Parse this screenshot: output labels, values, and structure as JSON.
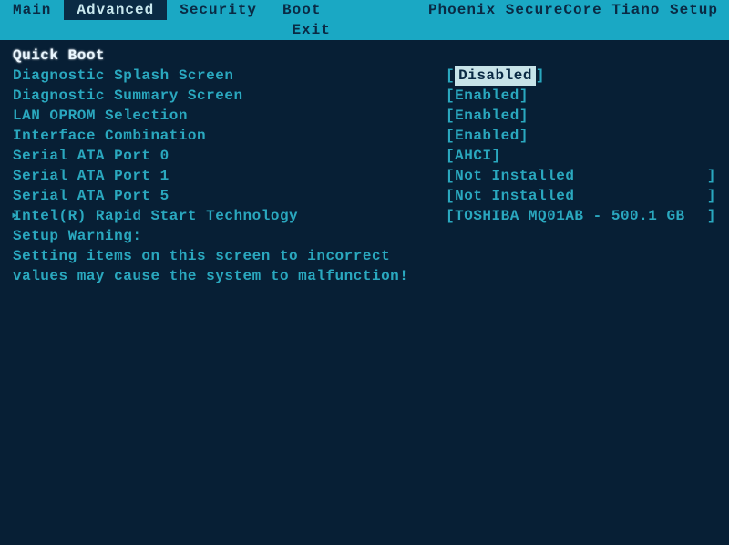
{
  "bios": {
    "title": "Phoenix SecureCore Tiano Setup",
    "tabs": {
      "main": "Main",
      "advanced": "Advanced",
      "security": "Security",
      "boot": "Boot",
      "exit": "Exit"
    }
  },
  "section_heading": "Quick Boot",
  "items": [
    {
      "label": "Diagnostic Splash Screen",
      "lb": "[",
      "val": "Disabled",
      "rb": "]",
      "selected": true
    },
    {
      "label": "Diagnostic Summary Screen",
      "lb": "[",
      "val": "Enabled",
      "rb": "]"
    },
    {
      "label": "LAN OPROM Selection",
      "lb": "[",
      "val": "Enabled",
      "rb": "]"
    },
    {
      "label": "Interface Combination",
      "lb": "[",
      "val": "Enabled",
      "rb": "]"
    },
    {
      "label": "Serial ATA Port 0",
      "lb": "[",
      "val": "AHCI",
      "rb": "]"
    },
    {
      "label": "Serial ATA Port 1",
      "lb": "[",
      "val": "Not Installed",
      "rb": "]",
      "wide": true
    },
    {
      "label": "Serial ATA Port 5",
      "lb": "[",
      "val": "Not Installed",
      "rb": "]",
      "wide": true
    },
    {
      "label": "Intel(R) Rapid Start Technology",
      "lb": "[",
      "val": "TOSHIBA MQ01AB - 500.1 GB",
      "rb": "]",
      "wide": true,
      "submenu": true
    }
  ],
  "warning": {
    "heading": "Setup Warning:",
    "line1": "Setting items on this screen to incorrect",
    "line2": "values may cause the system to malfunction!"
  }
}
